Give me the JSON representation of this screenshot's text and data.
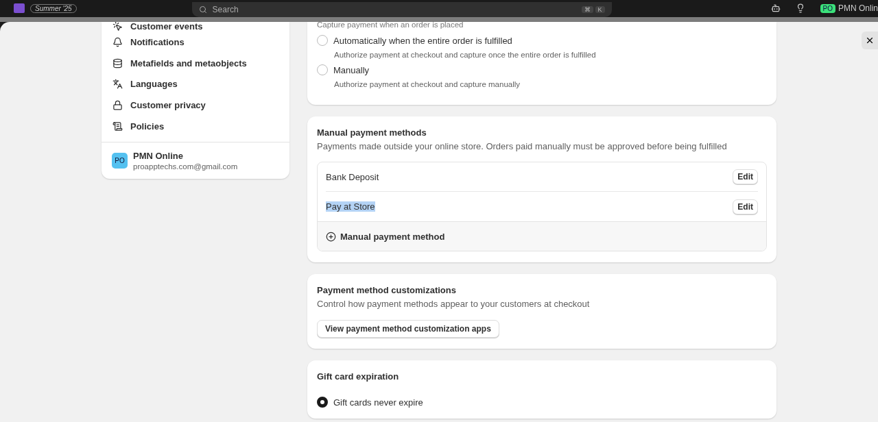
{
  "top_bar": {
    "badge": "Summer '25",
    "search": {
      "placeholder": "Search"
    },
    "shortcut": [
      "⌘",
      "K"
    ],
    "account": {
      "initials": "PO",
      "name": "PMN Onlin"
    }
  },
  "sidebar": {
    "items": [
      {
        "kind": "events",
        "label": "Customer events"
      },
      {
        "kind": "bell",
        "label": "Notifications"
      },
      {
        "kind": "meta",
        "label": "Metafields and metaobjects"
      },
      {
        "kind": "lang",
        "label": "Languages"
      },
      {
        "kind": "lock",
        "label": "Customer privacy"
      },
      {
        "kind": "policy",
        "label": "Policies"
      }
    ],
    "store": {
      "initials": "PO",
      "name": "PMN Online",
      "email": "proapptechs.com@gmail.com"
    }
  },
  "capture": {
    "note": "Capture payment when an order is placed",
    "options": [
      {
        "label": "Automatically when the entire order is fulfilled",
        "description": "Authorize payment at checkout and capture once the entire order is fulfilled",
        "selected": false
      },
      {
        "label": "Manually",
        "description": "Authorize payment at checkout and capture manually",
        "selected": false
      }
    ]
  },
  "manual_methods": {
    "title": "Manual payment methods",
    "description": "Payments made outside your online store. Orders paid manually must be approved before being fulfilled",
    "methods": [
      {
        "name": "Bank Deposit",
        "button": "Edit",
        "highlighted": false
      },
      {
        "name": "Pay at Store",
        "button": "Edit",
        "highlighted": true
      }
    ],
    "add": "Manual payment method"
  },
  "customizations": {
    "title": "Payment method customizations",
    "description": "Control how payment methods appear to your customers at checkout",
    "button": "View payment method customization apps"
  },
  "gift_cards": {
    "title": "Gift card expiration",
    "options": [
      {
        "label": "Gift cards never expire",
        "selected": true
      }
    ]
  }
}
